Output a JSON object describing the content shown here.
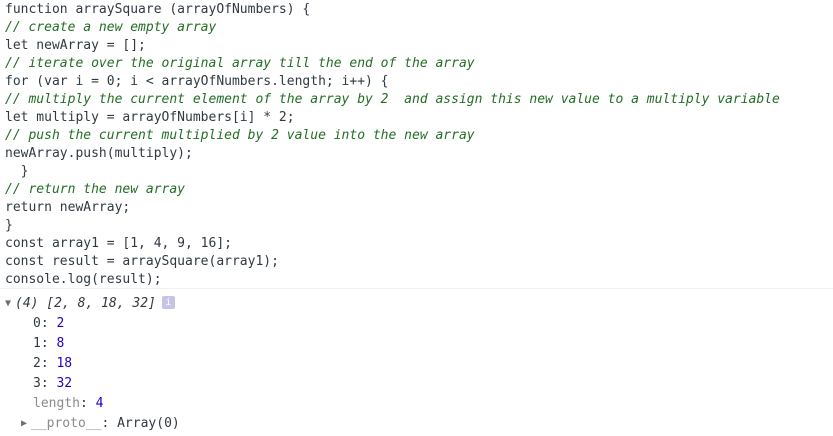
{
  "code_lines": [
    {
      "text": "function arraySquare (arrayOfNumbers) {",
      "kind": "code"
    },
    {
      "text": "// create a new empty array",
      "kind": "comment"
    },
    {
      "text": "let newArray = [];",
      "kind": "code"
    },
    {
      "text": "// iterate over the original array till the end of the array",
      "kind": "comment"
    },
    {
      "text": "for (var i = 0; i < arrayOfNumbers.length; i++) {",
      "kind": "code"
    },
    {
      "text": "// multiply the current element of the array by 2  and assign this new value to a multiply variable",
      "kind": "comment"
    },
    {
      "text": "let multiply = arrayOfNumbers[i] * 2;",
      "kind": "code"
    },
    {
      "text": "// push the current multiplied by 2 value into the new array",
      "kind": "comment"
    },
    {
      "text": "newArray.push(multiply);",
      "kind": "code"
    },
    {
      "text": "  }",
      "kind": "code"
    },
    {
      "text": "// return the new array",
      "kind": "comment"
    },
    {
      "text": "return newArray;",
      "kind": "code"
    },
    {
      "text": "}",
      "kind": "code"
    },
    {
      "text": "const array1 = [1, 4, 9, 16];",
      "kind": "code"
    },
    {
      "text": "const result = arraySquare(array1);",
      "kind": "code"
    },
    {
      "text": "console.log(result);",
      "kind": "code"
    }
  ],
  "output": {
    "summary": "(4) [2, 8, 18, 32]",
    "info_badge": "i",
    "expand_glyph": "▼",
    "collapsed_glyph": "▶",
    "entries": [
      {
        "key": "0",
        "value": "2"
      },
      {
        "key": "1",
        "value": "8"
      },
      {
        "key": "2",
        "value": "18"
      },
      {
        "key": "3",
        "value": "32"
      }
    ],
    "length": {
      "key": "length",
      "value": "4"
    },
    "proto": {
      "key": "__proto__",
      "value": "Array(0)"
    }
  },
  "colors": {
    "comment": "#236e25",
    "number": "#1c00cf",
    "dim_key": "#8b8b8b",
    "badge": "#c4c4e6"
  }
}
